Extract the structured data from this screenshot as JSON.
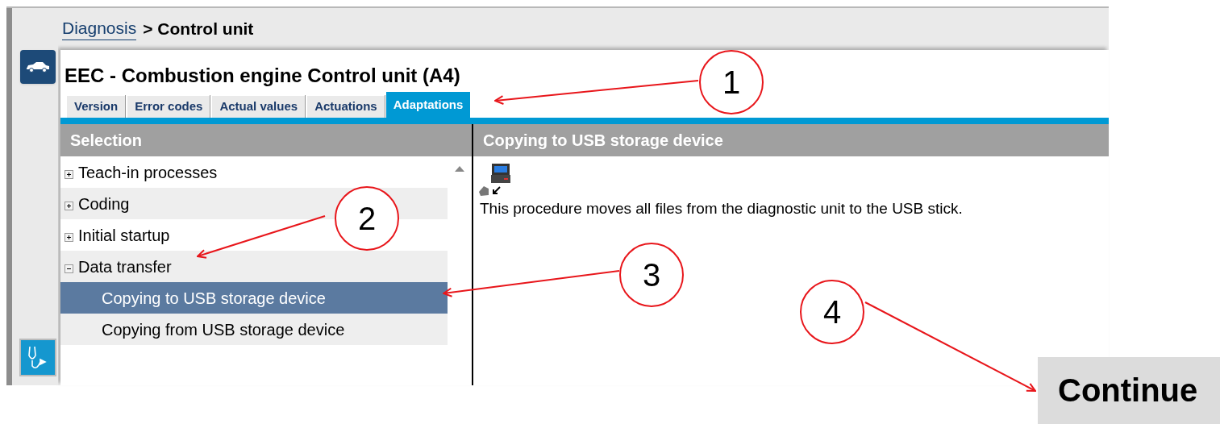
{
  "breadcrumb": {
    "link": "Diagnosis",
    "separator": ">",
    "current": "Control unit"
  },
  "title": "EEC - Combustion engine Control unit (A4)",
  "tabs": [
    {
      "label": "Version",
      "selected": false
    },
    {
      "label": "Error codes",
      "selected": false
    },
    {
      "label": "Actual values",
      "selected": false
    },
    {
      "label": "Actuations",
      "selected": false
    },
    {
      "label": "Adaptations",
      "selected": true
    }
  ],
  "selection": {
    "header": "Selection",
    "items": [
      {
        "label": "Teach-in processes",
        "expanded": false
      },
      {
        "label": "Coding",
        "expanded": false
      },
      {
        "label": "Initial startup",
        "expanded": false
      },
      {
        "label": "Data transfer",
        "expanded": true,
        "children": [
          {
            "label": "Copying to USB storage device",
            "selected": true
          },
          {
            "label": "Copying from USB storage device",
            "selected": false
          }
        ]
      }
    ]
  },
  "detail": {
    "header": "Copying to USB storage device",
    "text": "This procedure moves all files from the diagnostic unit to the USB stick."
  },
  "continue_button": "Continue",
  "annotations": [
    {
      "number": "1"
    },
    {
      "number": "2"
    },
    {
      "number": "3"
    },
    {
      "number": "4"
    }
  ]
}
